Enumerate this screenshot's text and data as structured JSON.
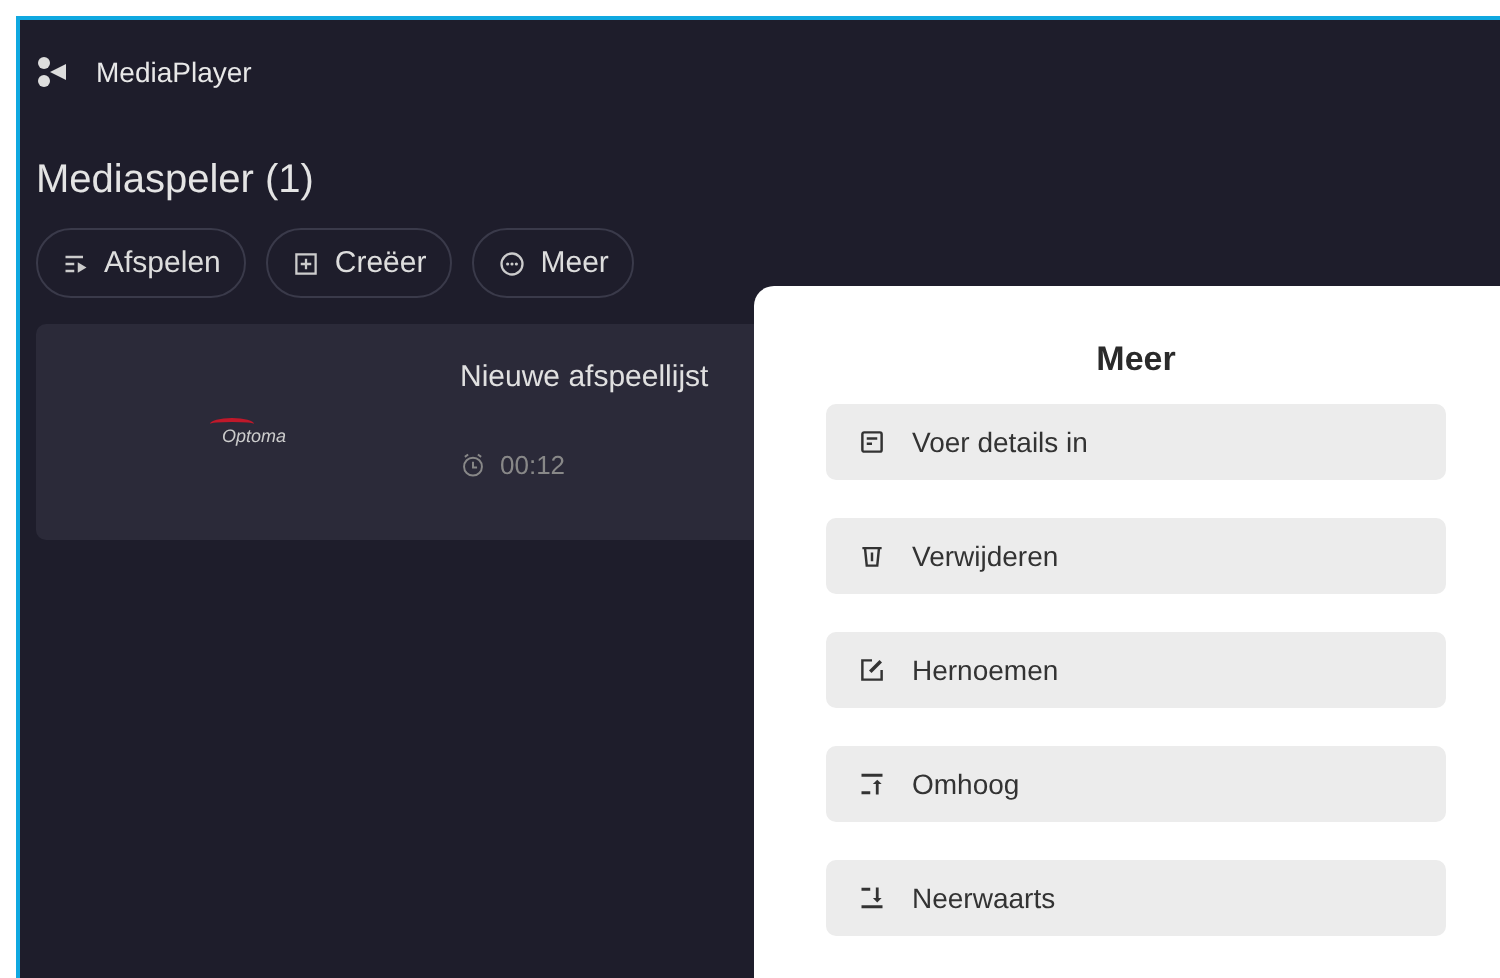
{
  "app": {
    "title": "MediaPlayer"
  },
  "heading": "Mediaspeler (1)",
  "toolbar": [
    {
      "kind": "play",
      "label": "Afspelen"
    },
    {
      "kind": "create",
      "label": "Creëer"
    },
    {
      "kind": "more",
      "label": "Meer"
    }
  ],
  "playlists": [
    {
      "logo": "Optoma",
      "title": "Nieuwe afspeellijst",
      "duration": "00:12"
    }
  ],
  "menu": {
    "title": "Meer",
    "items": [
      {
        "kind": "details",
        "label": "Voer details in"
      },
      {
        "kind": "delete",
        "label": "Verwijderen"
      },
      {
        "kind": "rename",
        "label": "Hernoemen"
      },
      {
        "kind": "up",
        "label": "Omhoog"
      },
      {
        "kind": "down",
        "label": "Neerwaarts"
      }
    ]
  }
}
